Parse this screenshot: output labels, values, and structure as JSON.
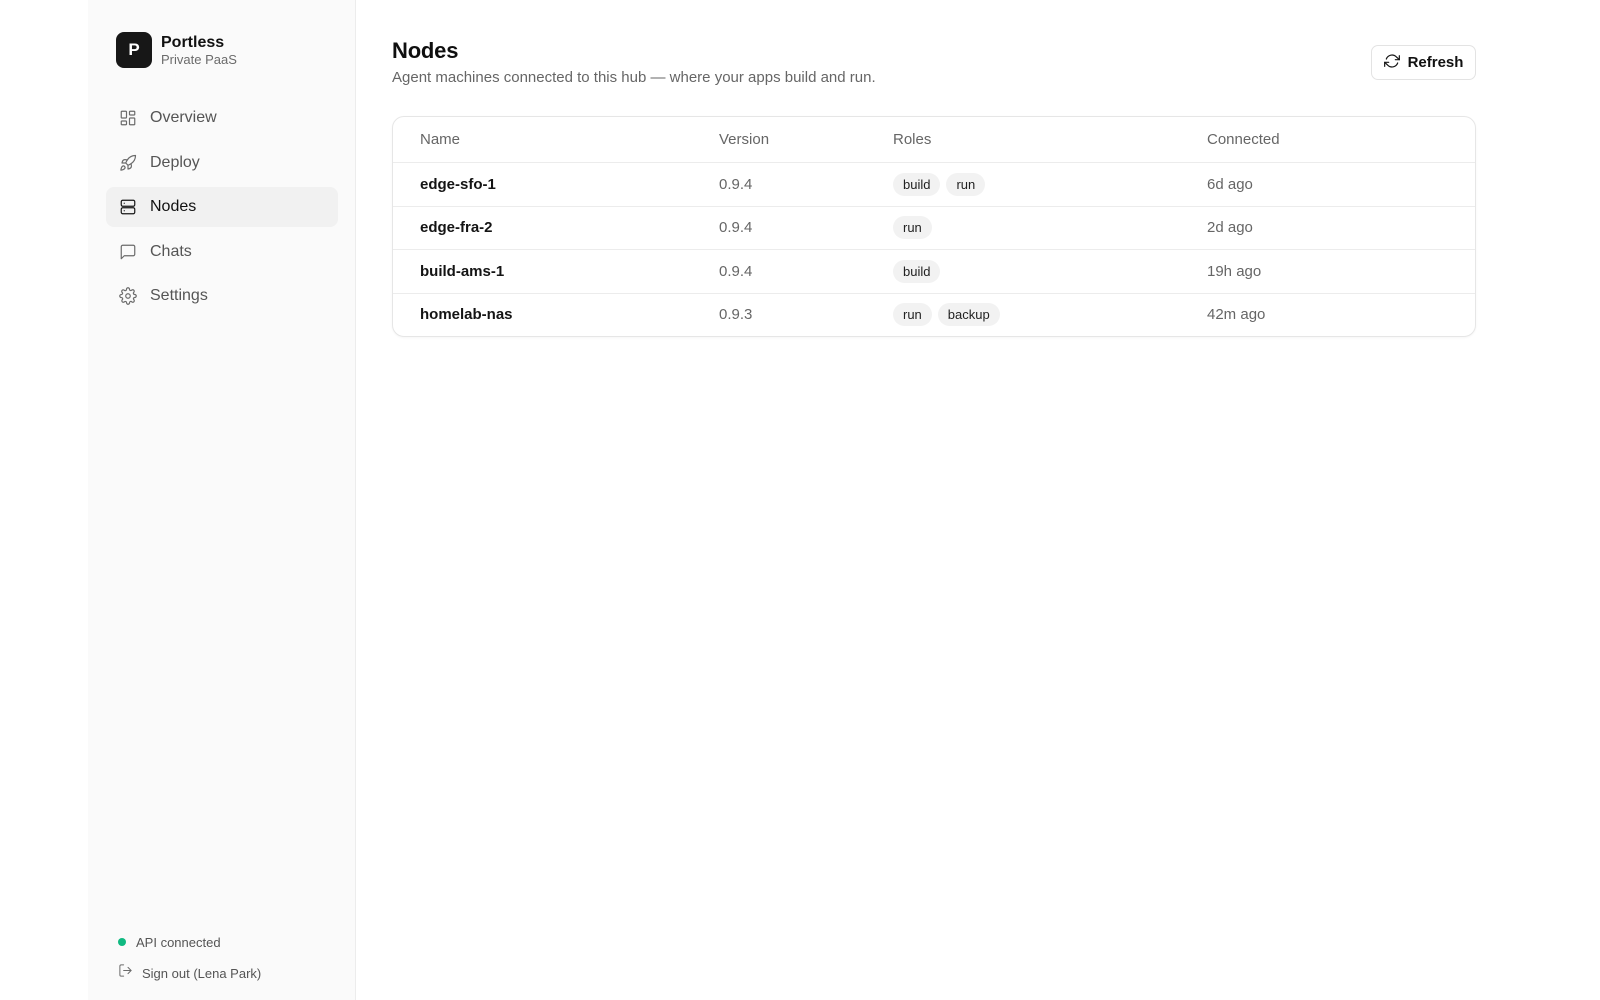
{
  "brand": {
    "initial": "P",
    "name": "Portless",
    "subtitle": "Private PaaS"
  },
  "nav": {
    "items": [
      {
        "label": "Overview",
        "icon": "layout-grid-icon",
        "active": false
      },
      {
        "label": "Deploy",
        "icon": "rocket-icon",
        "active": false
      },
      {
        "label": "Nodes",
        "icon": "server-icon",
        "active": true
      },
      {
        "label": "Chats",
        "icon": "message-square-icon",
        "active": false
      },
      {
        "label": "Settings",
        "icon": "gear-icon",
        "active": false
      }
    ]
  },
  "footer": {
    "status_text": "API connected",
    "status_color": "#10b981",
    "signout_label": "Sign out (Lena Park)"
  },
  "page": {
    "title": "Nodes",
    "subtitle": "Agent machines connected to this hub — where your apps build and run.",
    "refresh_label": "Refresh"
  },
  "table": {
    "columns": [
      "Name",
      "Version",
      "Roles",
      "Connected"
    ],
    "rows": [
      {
        "name": "edge-sfo-1",
        "version": "0.9.4",
        "roles": [
          "build",
          "run"
        ],
        "connected": "6d ago"
      },
      {
        "name": "edge-fra-2",
        "version": "0.9.4",
        "roles": [
          "run"
        ],
        "connected": "2d ago"
      },
      {
        "name": "build-ams-1",
        "version": "0.9.4",
        "roles": [
          "build"
        ],
        "connected": "19h ago"
      },
      {
        "name": "homelab-nas",
        "version": "0.9.3",
        "roles": [
          "run",
          "backup"
        ],
        "connected": "42m ago"
      }
    ]
  }
}
